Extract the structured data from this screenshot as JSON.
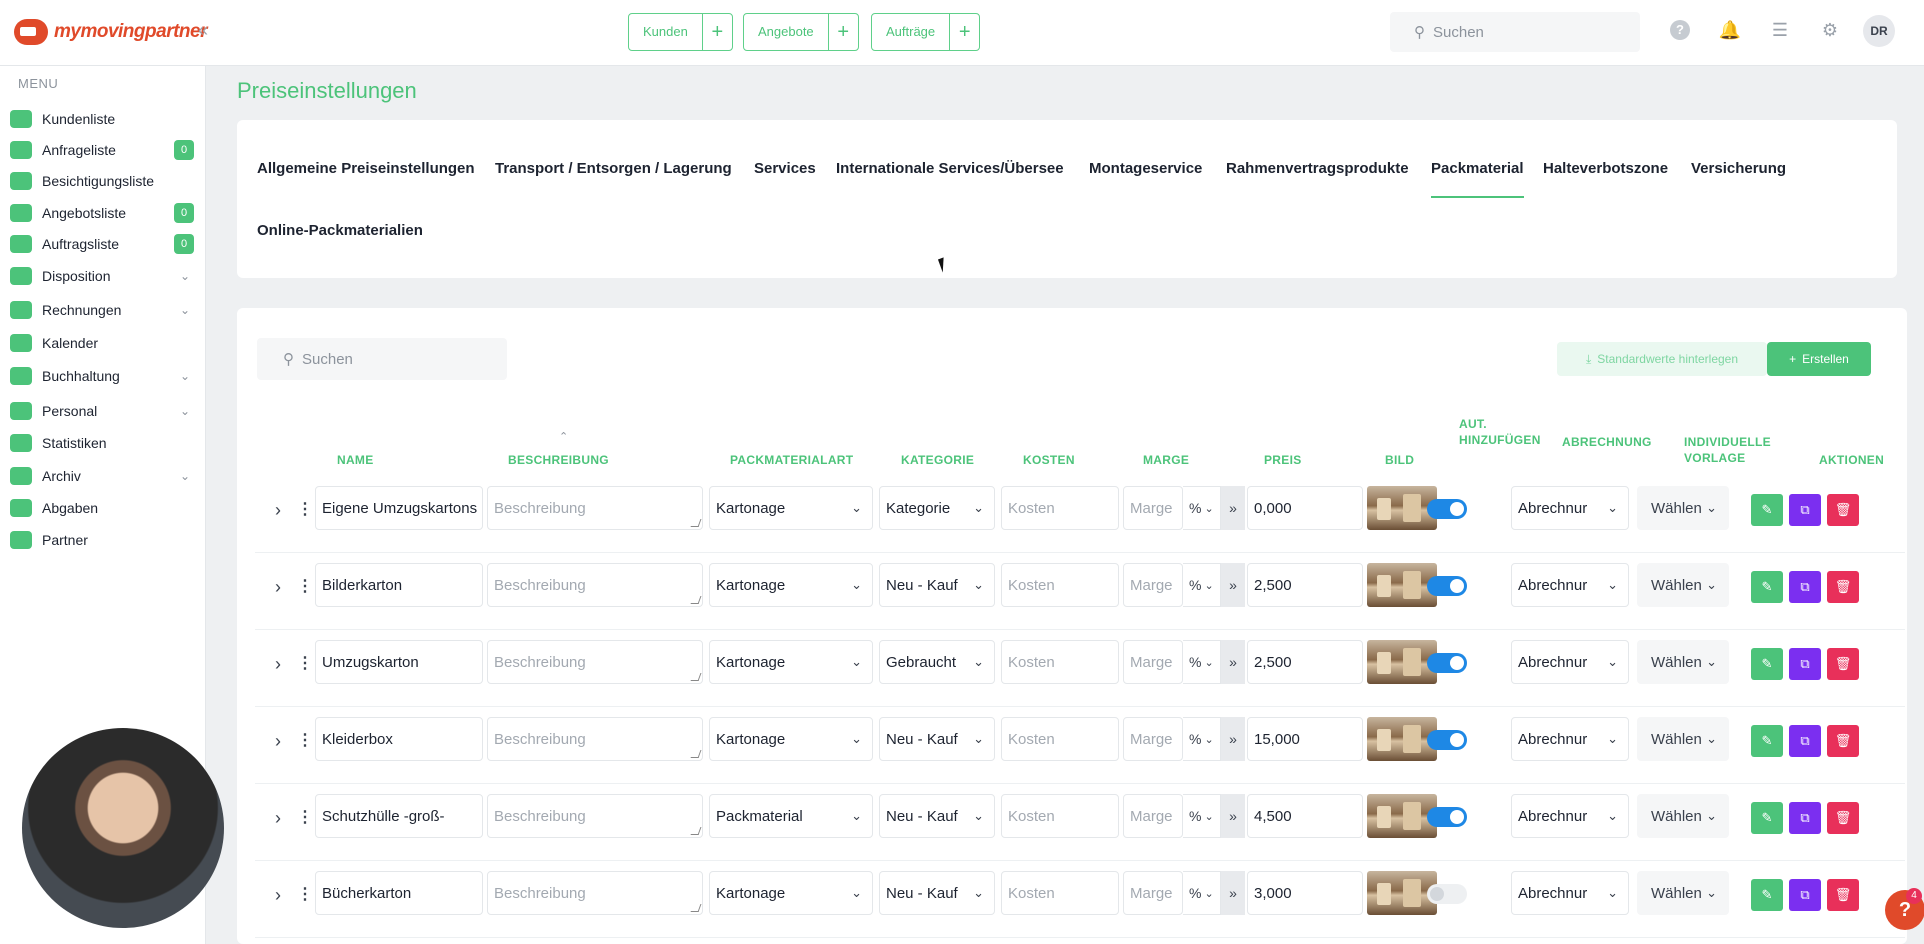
{
  "brand": {
    "name_part1": "mymoving",
    "name_part2": "partner"
  },
  "topbar": {
    "quick": [
      {
        "label": "Kunden"
      },
      {
        "label": "Angebote"
      },
      {
        "label": "Aufträge"
      }
    ],
    "search_placeholder": "Suchen",
    "avatar": "DR",
    "plus": "+"
  },
  "sidebar": {
    "menu_label": "MENU",
    "items": [
      {
        "label": "Kundenliste",
        "badge": null,
        "chevron": false
      },
      {
        "label": "Anfrageliste",
        "badge": "0",
        "chevron": false
      },
      {
        "label": "Besichtigungsliste",
        "badge": null,
        "chevron": false
      },
      {
        "label": "Angebotsliste",
        "badge": "0",
        "chevron": false
      },
      {
        "label": "Auftragsliste",
        "badge": "0",
        "chevron": false
      },
      {
        "label": "Disposition",
        "badge": null,
        "chevron": true
      },
      {
        "label": "Rechnungen",
        "badge": null,
        "chevron": true
      },
      {
        "label": "Kalender",
        "badge": null,
        "chevron": false
      },
      {
        "label": "Buchhaltung",
        "badge": null,
        "chevron": true
      },
      {
        "label": "Personal",
        "badge": null,
        "chevron": true
      },
      {
        "label": "Statistiken",
        "badge": null,
        "chevron": false
      },
      {
        "label": "Archiv",
        "badge": null,
        "chevron": true
      },
      {
        "label": "Abgaben",
        "badge": null,
        "chevron": false
      },
      {
        "label": "Partner",
        "badge": null,
        "chevron": false
      }
    ]
  },
  "page": {
    "title": "Preiseinstellungen",
    "tabs": [
      "Allgemeine Preiseinstellungen",
      "Transport / Entsorgen / Lagerung",
      "Services",
      "Internationale Services/Übersee",
      "Montageservice",
      "Rahmenvertragsprodukte",
      "Packmaterial",
      "Halteverbotszone",
      "Versicherung",
      "Online-Packmaterialien"
    ],
    "active_tab": "Packmaterial"
  },
  "table": {
    "search_placeholder": "Suchen",
    "btn_default": "Standardwerte hinterlegen",
    "btn_create": "Erstellen",
    "headers": {
      "name": "NAME",
      "beschreibung": "BESCHREIBUNG",
      "packmaterialart": "PACKMATERIALART",
      "kategorie": "KATEGORIE",
      "kosten": "KOSTEN",
      "marge": "MARGE",
      "preis": "PREIS",
      "bild": "BILD",
      "aut1": "AUT.",
      "aut2": "HINZUFÜGEN",
      "abrechnung": "ABRECHNUNG",
      "vorlage1": "INDIVIDUELLE",
      "vorlage2": "VORLAGE",
      "aktionen": "AKTIONEN"
    },
    "placeholders": {
      "beschreibung": "Beschreibung",
      "kosten": "Kosten",
      "marge": "Marge",
      "abrechnung": "Abrechnur",
      "vorlage": "Wählen",
      "pct": "%"
    },
    "rows": [
      {
        "name": "Eigene Umzugskartons",
        "art": "Kartonage",
        "kategorie": "Kategorie",
        "preis": "0,000",
        "auto": true
      },
      {
        "name": "Bilderkarton",
        "art": "Kartonage",
        "kategorie": "Neu - Kauf",
        "preis": "2,500",
        "auto": true
      },
      {
        "name": "Umzugskarton",
        "art": "Kartonage",
        "kategorie": "Gebraucht",
        "preis": "2,500",
        "auto": true
      },
      {
        "name": "Kleiderbox",
        "art": "Kartonage",
        "kategorie": "Neu - Kauf",
        "preis": "15,000",
        "auto": true
      },
      {
        "name": "Schutzhülle -groß-",
        "art": "Packmaterial",
        "kategorie": "Neu - Kauf",
        "preis": "4,500",
        "auto": true
      },
      {
        "name": "Bücherkarton",
        "art": "Kartonage",
        "kategorie": "Neu - Kauf",
        "preis": "3,000",
        "auto": false
      }
    ]
  },
  "help": {
    "label": "?",
    "count": "4"
  },
  "colors": {
    "accent": "#4cc37a",
    "brand": "#e04a2a",
    "purple": "#7b2ff0",
    "danger": "#e8305a",
    "toggle": "#1e88e5"
  }
}
